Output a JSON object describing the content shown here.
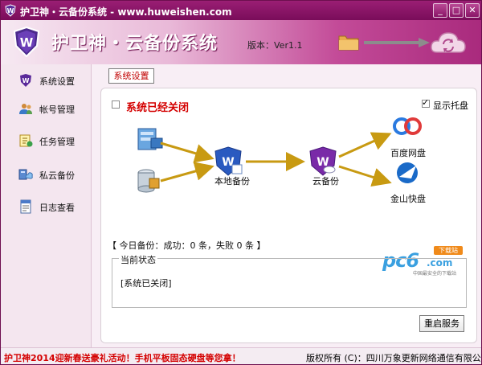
{
  "window": {
    "title": "护卫神・云备份系统 - www.huweishen.com",
    "minimize_glyph": "_",
    "maximize_glyph": "□",
    "close_glyph": "✕"
  },
  "banner": {
    "title": "护卫神・云备份系统",
    "version": "版本：Ver1.1"
  },
  "sidebar": {
    "items": [
      {
        "label": "系统设置",
        "icon": "gear-shield-icon"
      },
      {
        "label": "帐号管理",
        "icon": "users-icon"
      },
      {
        "label": "任务管理",
        "icon": "task-icon"
      },
      {
        "label": "私云备份",
        "icon": "cloud-backup-icon"
      },
      {
        "label": "日志查看",
        "icon": "log-icon"
      }
    ]
  },
  "main": {
    "tab_label": "系统设置",
    "status_text": "系统已经关闭",
    "status_checked": false,
    "tray_label": "显示托盘",
    "tray_checked": true,
    "flow": {
      "local_backup_label": "本地备份",
      "cloud_backup_label": "云备份",
      "baidu_label": "百度网盘",
      "kingsoft_label": "金山快盘"
    },
    "today_summary": "【 今日备份：成功：0 条，失败 0 条 】",
    "status_group": {
      "legend": "当前状态",
      "text": "[系统已关闭]"
    },
    "restart_button": "重启服务",
    "watermark": {
      "brand": "pc6",
      "domain": ".com",
      "tag": "下载站",
      "sub": "中国最安全的下载站"
    }
  },
  "footer": {
    "promo": "护卫神2014迎新春送豪礼活动！手机平板固态硬盘等您拿！",
    "copyright": "版权所有 (C)：四川万象更新网络通信有限公司"
  },
  "colors": {
    "title_bar": "#8a1567",
    "accent_red": "#d40000",
    "arrow_gold": "#c89a12",
    "link_blue": "#3aa0e0"
  }
}
